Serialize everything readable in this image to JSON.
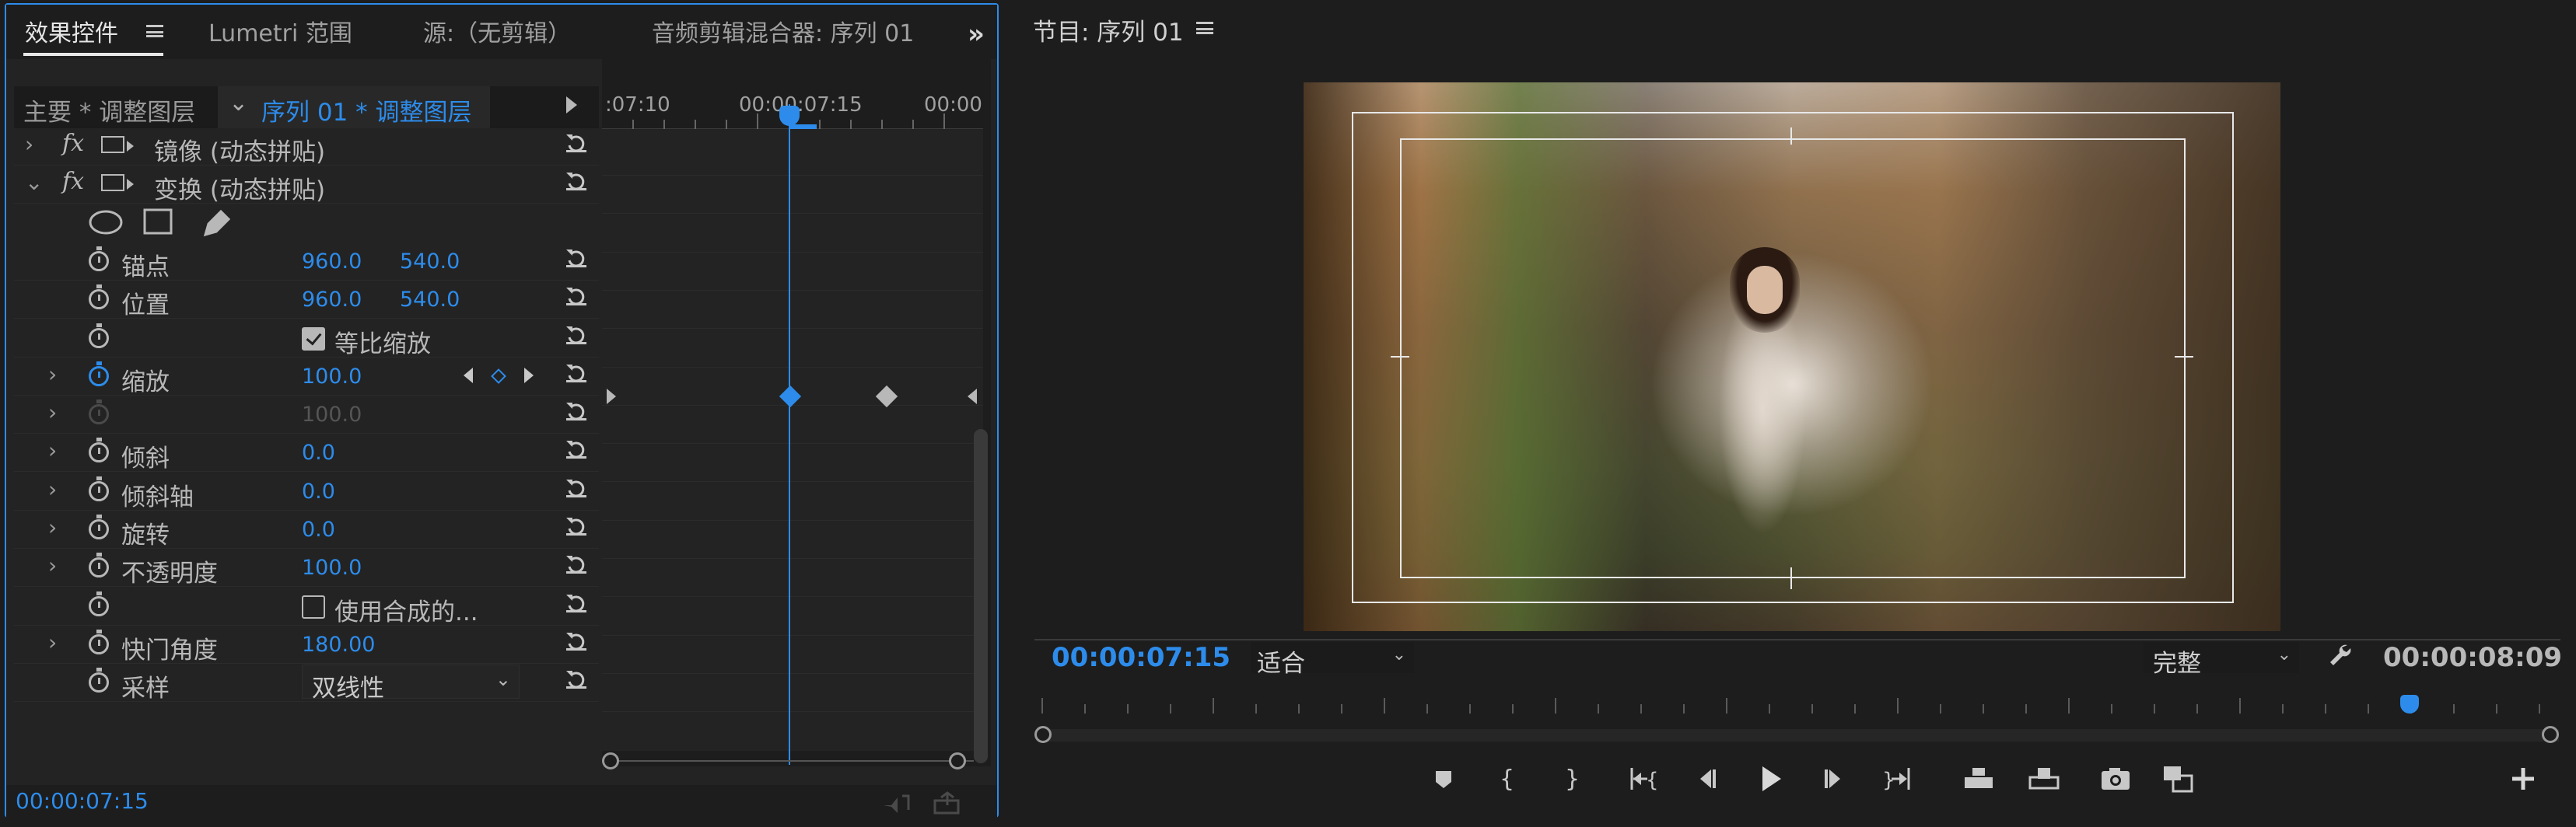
{
  "effect_controls": {
    "tabs": [
      "效果控件",
      "Lumetri 范围",
      "源:（无剪辑）",
      "音频剪辑混合器: 序列 01"
    ],
    "master_label": "主要 * 调整图层",
    "sequence_label": "序列 01 * 调整图层",
    "timeline_ticks": [
      ":07:10",
      "00:00:07:15",
      "00:00"
    ],
    "effects": [
      {
        "label": "镜像 (动态拼贴)",
        "expanded": false
      },
      {
        "label": "变换 (动态拼贴)",
        "expanded": true
      }
    ],
    "params": [
      {
        "key": "anchor",
        "label": "锚点",
        "x": "960.0",
        "y": "540.0"
      },
      {
        "key": "position",
        "label": "位置",
        "x": "960.0",
        "y": "540.0"
      },
      {
        "key": "uniform",
        "label": "等比缩放",
        "checked": true
      },
      {
        "key": "scale",
        "label": "缩放",
        "value": "100.0",
        "animated": true
      },
      {
        "key": "scale_w",
        "label": "",
        "value": "100.0",
        "disabled": true
      },
      {
        "key": "skew",
        "label": "倾斜",
        "value": "0.0"
      },
      {
        "key": "skew_axis",
        "label": "倾斜轴",
        "value": "0.0"
      },
      {
        "key": "rotation",
        "label": "旋转",
        "value": "0.0"
      },
      {
        "key": "opacity",
        "label": "不透明度",
        "value": "100.0"
      },
      {
        "key": "use_comp",
        "label": "使用合成的...",
        "checked": false
      },
      {
        "key": "shutter",
        "label": "快门角度",
        "value": "180.00"
      },
      {
        "key": "sampling",
        "label": "采样",
        "value": "双线性"
      }
    ],
    "current_time": "00:00:07:15"
  },
  "program_monitor": {
    "title": "节目: 序列 01",
    "current_time": "00:00:07:15",
    "fit": "适合",
    "quality": "完整",
    "duration": "00:00:08:09"
  },
  "colors": {
    "accent": "#2d8ceb",
    "panel": "#232323",
    "bg": "#1d1d1d"
  },
  "icons": [
    "hamburger-icon",
    "chevron-right-icon",
    "stopwatch-icon",
    "reset-icon",
    "ellipse-mask-icon",
    "rect-mask-icon",
    "pen-icon",
    "keyframe-icon",
    "wrench-icon",
    "add-marker-icon",
    "mark-in-icon",
    "mark-out-icon",
    "go-to-in-icon",
    "step-back-icon",
    "play-icon",
    "step-forward-icon",
    "go-to-out-icon",
    "insert-icon",
    "overwrite-icon",
    "export-frame-icon",
    "compare-icon",
    "plus-icon"
  ]
}
